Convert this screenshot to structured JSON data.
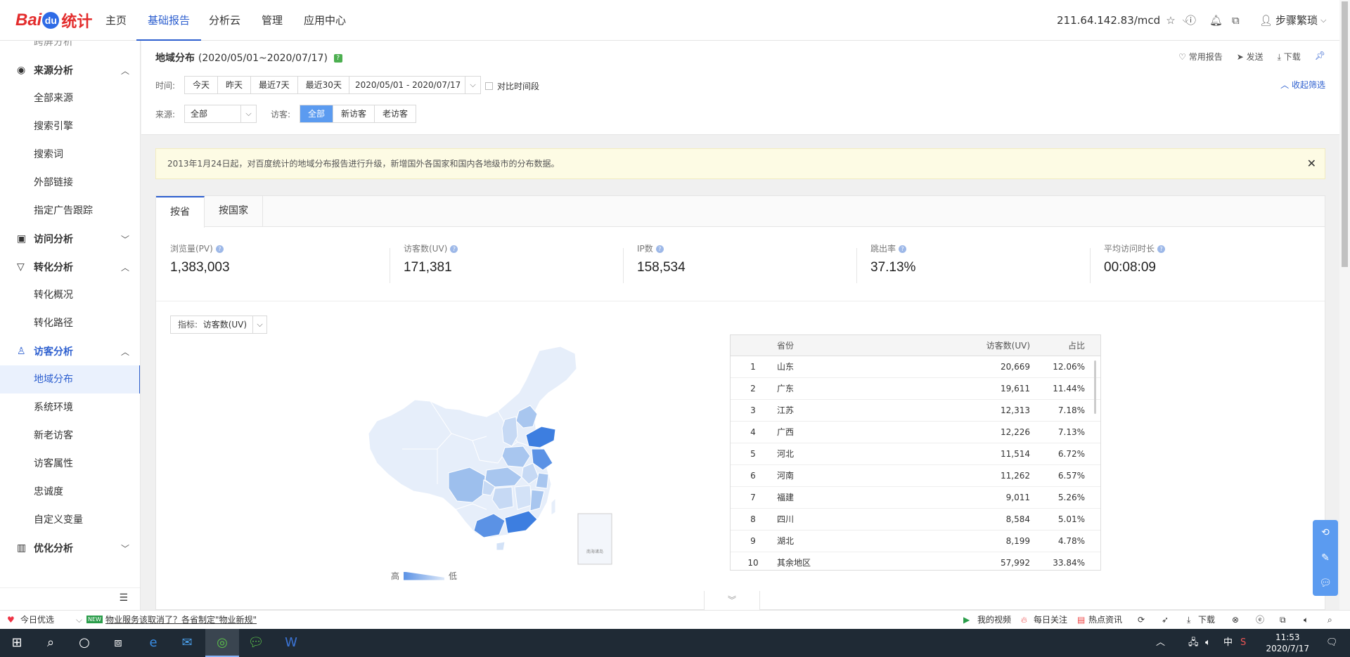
{
  "topnav": {
    "logo": {
      "bai": "Bai",
      "du": "du",
      "tj": "统计"
    },
    "items": [
      "主页",
      "基础报告",
      "分析云",
      "管理",
      "应用中心"
    ],
    "site": "211.64.142.83/mcd",
    "user": "步骤繁琐"
  },
  "sidebar": {
    "partial_item": "跨屏分析",
    "groups": {
      "source": "来源分析",
      "visit": "访问分析",
      "conversion": "转化分析",
      "visitor": "访客分析",
      "optimize": "优化分析"
    },
    "source_items": [
      "全部来源",
      "搜索引擎",
      "搜索词",
      "外部链接",
      "指定广告跟踪"
    ],
    "conversion_items": [
      "转化概况",
      "转化路径"
    ],
    "visitor_items": [
      "地域分布",
      "系统环境",
      "新老访客",
      "访客属性",
      "忠诚度",
      "自定义变量"
    ]
  },
  "page": {
    "title": "地域分布",
    "range": "(2020/05/01~2020/07/17)",
    "tools": {
      "common": "常用报告",
      "send": "发送",
      "download": "下载"
    },
    "collapse": "收起筛选"
  },
  "filters": {
    "time_label": "时间:",
    "time_buttons": [
      "今天",
      "昨天",
      "最近7天",
      "最近30天"
    ],
    "date_range": "2020/05/01 - 2020/07/17",
    "compare_label": "对比时间段",
    "source_label": "来源:",
    "source_value": "全部",
    "visitor_label": "访客:",
    "visitor_buttons": [
      "全部",
      "新访客",
      "老访客"
    ]
  },
  "notice": "2013年1月24日起，对百度统计的地域分布报告进行升级，新增国外各国家和国内各地级市的分布数据。",
  "tabs": [
    "按省",
    "按国家"
  ],
  "kpis": [
    {
      "label": "浏览量(PV)",
      "value": "1,383,003"
    },
    {
      "label": "访客数(UV)",
      "value": "171,381"
    },
    {
      "label": "IP数",
      "value": "158,534"
    },
    {
      "label": "跳出率",
      "value": "37.13%"
    },
    {
      "label": "平均访问时长",
      "value": "00:08:09"
    }
  ],
  "metric": {
    "label": "指标:",
    "value": "访客数(UV)"
  },
  "legend": {
    "high": "高",
    "low": "低"
  },
  "inset": {
    "label": "南海诸岛"
  },
  "table": {
    "headers": {
      "province": "省份",
      "uv": "访客数(UV)",
      "share": "占比"
    },
    "rows": [
      {
        "rank": "1",
        "province": "山东",
        "uv": "20,669",
        "share": "12.06%"
      },
      {
        "rank": "2",
        "province": "广东",
        "uv": "19,611",
        "share": "11.44%"
      },
      {
        "rank": "3",
        "province": "江苏",
        "uv": "12,313",
        "share": "7.18%"
      },
      {
        "rank": "4",
        "province": "广西",
        "uv": "12,226",
        "share": "7.13%"
      },
      {
        "rank": "5",
        "province": "河北",
        "uv": "11,514",
        "share": "6.72%"
      },
      {
        "rank": "6",
        "province": "河南",
        "uv": "11,262",
        "share": "6.57%"
      },
      {
        "rank": "7",
        "province": "福建",
        "uv": "9,011",
        "share": "5.26%"
      },
      {
        "rank": "8",
        "province": "四川",
        "uv": "8,584",
        "share": "5.01%"
      },
      {
        "rank": "9",
        "province": "湖北",
        "uv": "8,199",
        "share": "4.78%"
      },
      {
        "rank": "10",
        "province": "其余地区",
        "uv": "57,992",
        "share": "33.84%"
      }
    ]
  },
  "statusbar": {
    "left": "今日优选",
    "new_badge": "NEW",
    "news": "物业服务该取消了？各省制定\"物业新规\"",
    "my_video": "我的视频",
    "daily": "每日关注",
    "hot": "热点资讯",
    "download": "下载"
  },
  "taskbar": {
    "ime": "中",
    "time": "11:53",
    "date": "2020/7/17"
  },
  "colors": {
    "accent": "#2d5fcf",
    "map_high": "#3d7ee0",
    "map_low": "#e8f0fb"
  }
}
